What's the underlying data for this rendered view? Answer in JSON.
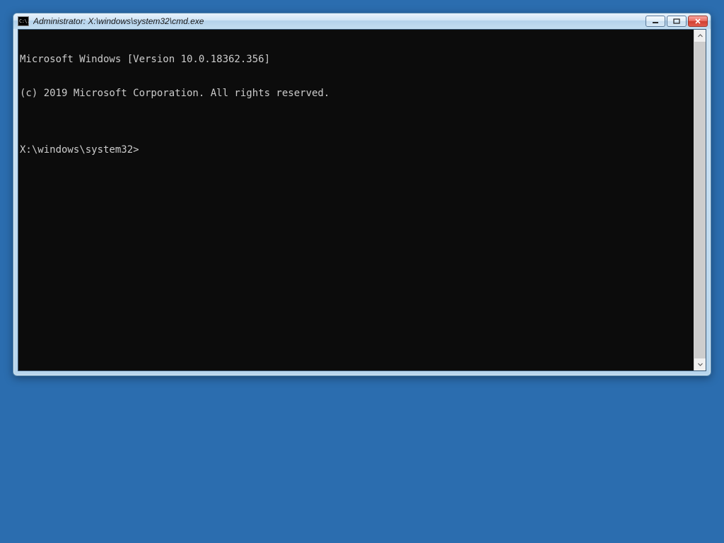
{
  "window": {
    "title": "Administrator: X:\\windows\\system32\\cmd.exe",
    "app_icon_glyph": "C:\\.",
    "controls": {
      "minimize_label": "Minimize",
      "maximize_label": "Maximize",
      "close_label": "Close"
    }
  },
  "terminal": {
    "lines": [
      "Microsoft Windows [Version 10.0.18362.356]",
      "(c) 2019 Microsoft Corporation. All rights reserved.",
      "",
      "X:\\windows\\system32>"
    ],
    "prompt_path": "X:\\windows\\system32>",
    "version_line": "Microsoft Windows [Version 10.0.18362.356]",
    "copyright_line": "(c) 2019 Microsoft Corporation. All rights reserved."
  },
  "colors": {
    "desktop_bg": "#2b6daf",
    "terminal_bg": "#0c0c0c",
    "terminal_fg": "#cccccc",
    "window_chrome_top": "#d1e5f5",
    "close_btn": "#d13f30"
  }
}
